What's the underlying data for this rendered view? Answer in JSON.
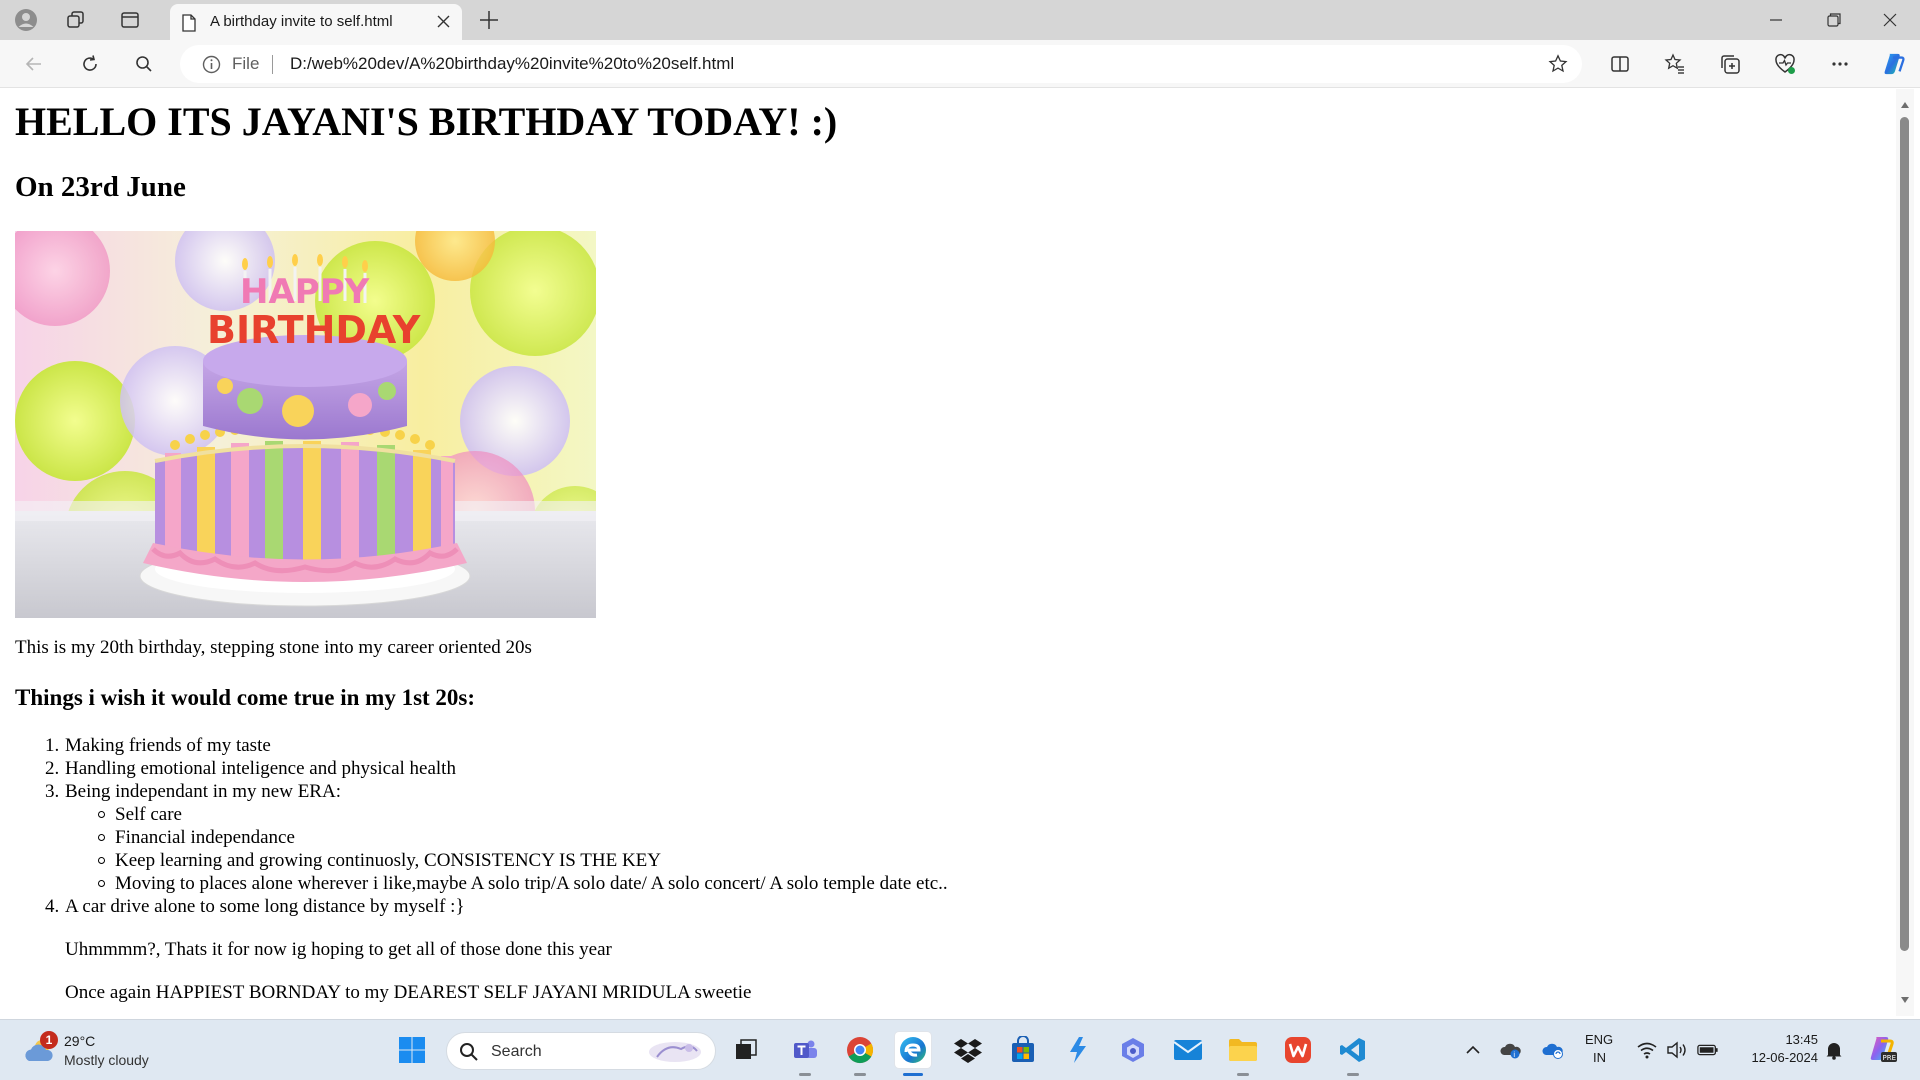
{
  "browser": {
    "tab_title": "A birthday invite to self.html",
    "address_scheme": "File",
    "address_url": "D:/web%20dev/A%20birthday%20invite%20to%20self.html"
  },
  "page": {
    "heading": "HELLO ITS JAYANI'S BIRTHDAY TODAY! :)",
    "date_heading": "On 23rd June",
    "intro": "This is my 20th birthday, stepping stone into my career oriented 20s",
    "wishes_heading": "Things i wish it would come true in my 1st 20s:",
    "wishes": [
      {
        "num": "1.",
        "text": "Making friends of my taste"
      },
      {
        "num": "2.",
        "text": "Handling emotional inteligence and physical health"
      },
      {
        "num": "3.",
        "text": "Being independant in my new ERA:"
      }
    ],
    "sub_wishes": [
      "Self care",
      "Financial independance",
      "Keep learning and growing continuosly, CONSISTENCY IS THE KEY",
      "Moving to places alone wherever i like,maybe A solo trip/A solo date/ A solo concert/ A solo temple date etc.."
    ],
    "wish_4": {
      "num": "4.",
      "text": "A car drive alone to some long distance by myself :}"
    },
    "closing_1": "Uhmmmm?, Thats it for now ig hoping to get all of those done this year",
    "closing_2": "Once again HAPPIEST BORNDAY to my DEAREST SELF JAYANI MRIDULA sweetie",
    "cake_topper": [
      "HAPPY",
      "BIRTHDAY"
    ]
  },
  "taskbar": {
    "weather_badge": "1",
    "weather_temp": "29°C",
    "weather_desc": "Mostly cloudy",
    "search_placeholder": "Search",
    "lang_line1": "ENG",
    "lang_line2": "IN",
    "time": "13:45",
    "date": "12-06-2024"
  },
  "colors": {
    "accent": "#1f6fd1",
    "taskbar_bg": "#dfe8f2",
    "titlebar_bg": "#d6d6d6"
  }
}
